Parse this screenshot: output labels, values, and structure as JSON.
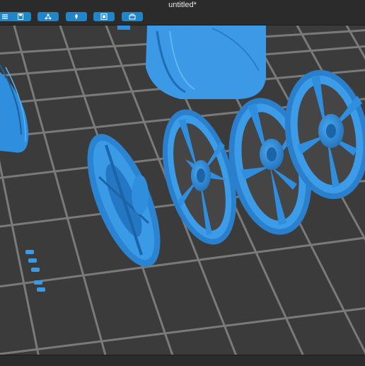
{
  "window": {
    "title": "untitled*"
  },
  "toolbar": {
    "buttons": [
      {
        "name": "menu-button",
        "icon": "menu-icon"
      },
      {
        "name": "save-button",
        "icon": "save-icon"
      },
      {
        "name": "share-button",
        "icon": "share-icon"
      },
      {
        "name": "support-button",
        "icon": "support-icon"
      },
      {
        "name": "slice-button",
        "icon": "slice-icon"
      },
      {
        "name": "print-button",
        "icon": "print-icon"
      }
    ]
  },
  "scene": {
    "grid_color": "#7a7a7a",
    "background_color": "#3b3b3b",
    "model_color": "#2f8fde",
    "objects": [
      "tire-rim",
      "tire-rim-left",
      "wheel-face-flat",
      "wheel-1",
      "wheel-2",
      "wheel-3",
      "lug-nuts"
    ]
  }
}
